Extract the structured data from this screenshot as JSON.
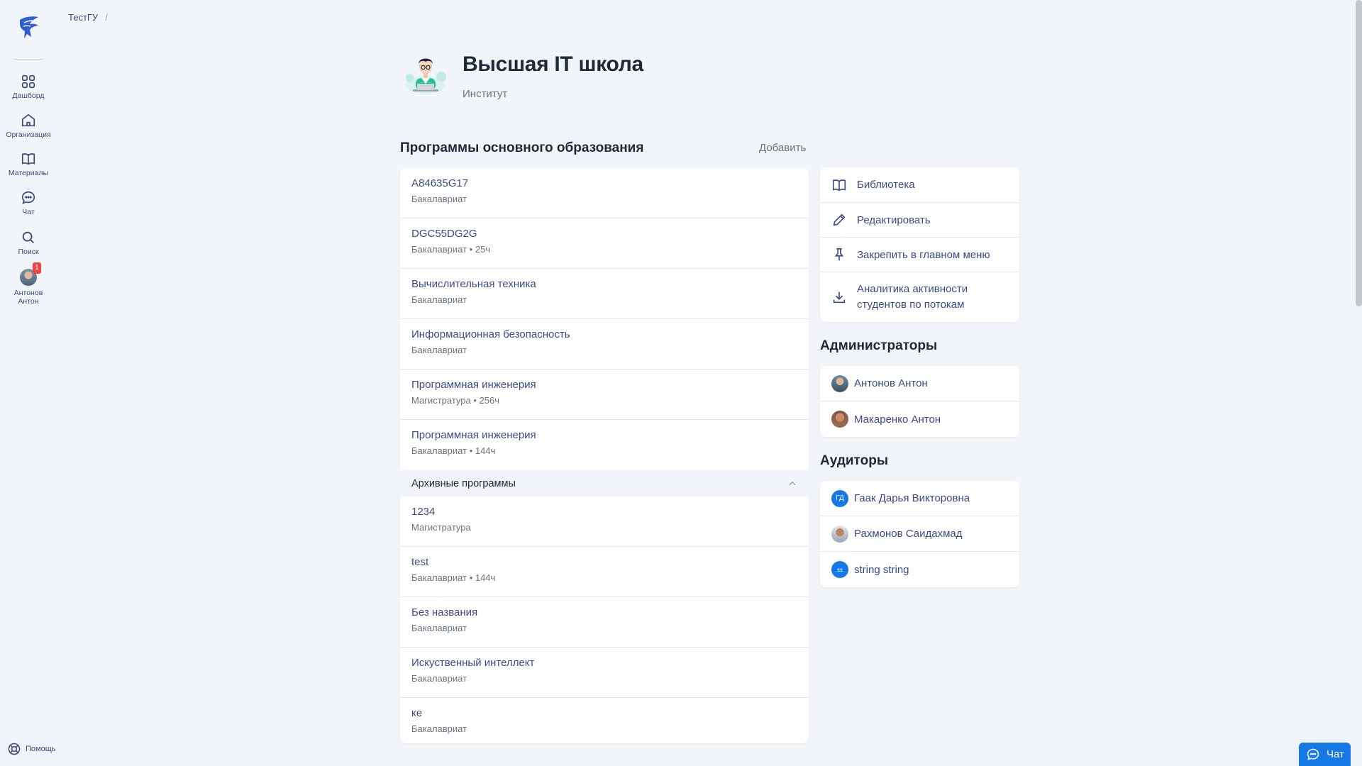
{
  "nav": {
    "items": [
      {
        "icon": "dashboard-icon",
        "label": "Дашборд"
      },
      {
        "icon": "home-icon",
        "label": "Организация"
      },
      {
        "icon": "book-icon",
        "label": "Материалы"
      },
      {
        "icon": "chat-icon",
        "label": "Чат"
      },
      {
        "icon": "search-icon",
        "label": "Поиск"
      }
    ],
    "profile": {
      "label_line1": "Антонов",
      "label_line2": "Антон",
      "badge": "1"
    },
    "help_label": "Помощь"
  },
  "breadcrumb": {
    "root": "ТестГУ",
    "separator": "/"
  },
  "header": {
    "title": "Высшая IT школа",
    "subtitle": "Институт"
  },
  "programs": {
    "title": "Программы основного образования",
    "add_label": "Добавить",
    "items": [
      {
        "name": "A84635G17",
        "meta": "Бакалавриат"
      },
      {
        "name": "DGC55DG2G",
        "meta": "Бакалавриат • 25ч"
      },
      {
        "name": "Вычислительная техника",
        "meta": "Бакалавриат"
      },
      {
        "name": "Информационная безопасность",
        "meta": "Бакалавриат"
      },
      {
        "name": "Программная инженерия",
        "meta": "Магистратура • 256ч"
      },
      {
        "name": "Программная инженерия",
        "meta": "Бакалавриат • 144ч"
      }
    ],
    "archive": {
      "title": "Архивные программы",
      "items": [
        {
          "name": "1234",
          "meta": "Магистратура"
        },
        {
          "name": "test",
          "meta": "Бакалавриат • 144ч"
        },
        {
          "name": "Без названия",
          "meta": "Бакалавриат"
        },
        {
          "name": "Искуственный интеллект",
          "meta": "Бакалавриат"
        },
        {
          "name": "ке",
          "meta": "Бакалавриат"
        }
      ]
    }
  },
  "actions": {
    "library": "Библиотека",
    "edit": "Редактировать",
    "pin": "Закрепить в главном меню",
    "analytics_line1": "Аналитика активности",
    "analytics_line2": "студентов по потокам"
  },
  "admins": {
    "title": "Администраторы",
    "people": [
      {
        "name": "Антонов Антон"
      },
      {
        "name": "Макаренко Антон"
      }
    ]
  },
  "auditors": {
    "title": "Аудиторы",
    "people": [
      {
        "name": "Гаак Дарья Викторовна",
        "initials": "ГД"
      },
      {
        "name": "Рахмонов Саидахмад"
      },
      {
        "name": "string string",
        "initials": "ss"
      }
    ]
  },
  "chat_button": {
    "label": "Чат"
  },
  "colors": {
    "accent": "#1677e6",
    "link": "#3b4a8a",
    "background": "#f1f4f8",
    "badge": "#ef4444"
  }
}
